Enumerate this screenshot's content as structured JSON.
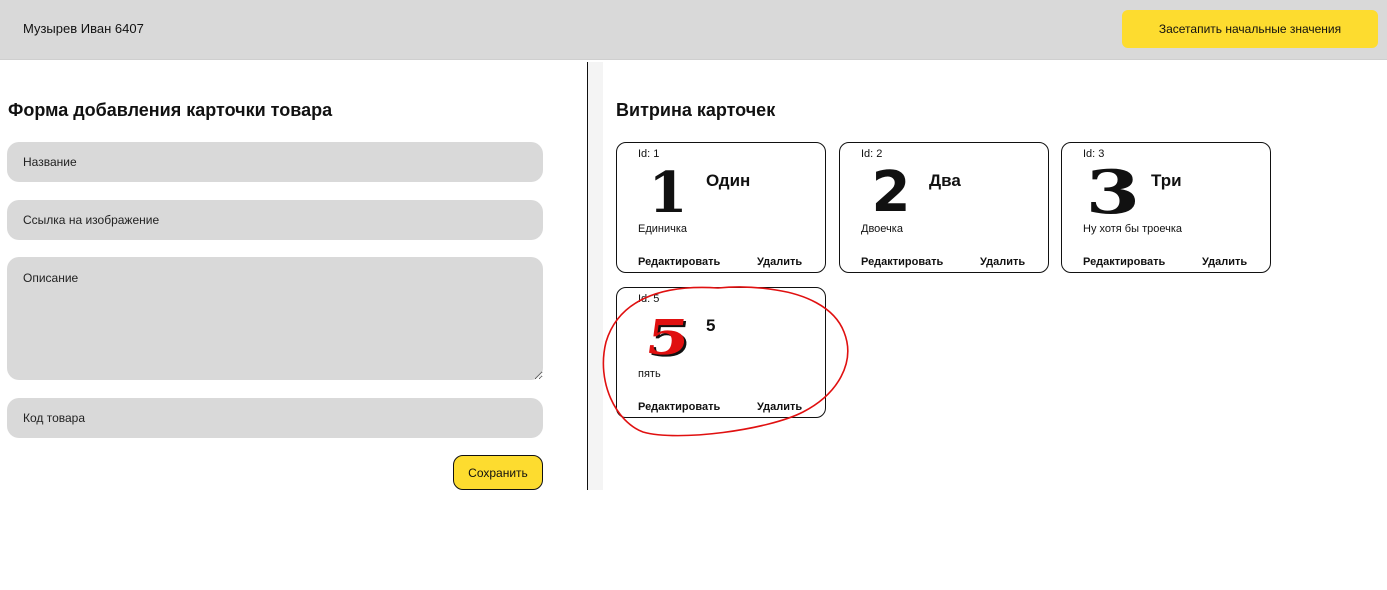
{
  "header": {
    "user": "Музырев Иван 6407",
    "reset_label": "Засетапить начальные значения"
  },
  "form": {
    "title": "Форма добавления карточки товара",
    "name_placeholder": "Название",
    "image_placeholder": "Ссылка на изображение",
    "description_placeholder": "Описание",
    "code_placeholder": "Код товара",
    "save_label": "Сохранить"
  },
  "showcase": {
    "title": "Витрина карточек",
    "cards": [
      {
        "id_label": "Id: 1",
        "title": "Один",
        "description": "Единичка",
        "image_glyph": "1",
        "image_color": "#111111",
        "edit_label": "Редактировать",
        "delete_label": "Удалить"
      },
      {
        "id_label": "Id: 2",
        "title": "Два",
        "description": "Двоечка",
        "image_glyph": "2",
        "image_color": "#111111",
        "edit_label": "Редактировать",
        "delete_label": "Удалить"
      },
      {
        "id_label": "Id: 3",
        "title": "Три",
        "description": "Ну хотя бы троечка",
        "image_glyph": "3",
        "image_color": "#111111",
        "edit_label": "Редактировать",
        "delete_label": "Удалить"
      },
      {
        "id_label": "Id: 5",
        "title": "5",
        "description": "пять",
        "image_glyph": "5",
        "image_color": "#e01010",
        "edit_label": "Редактировать",
        "delete_label": "Удалить"
      }
    ]
  },
  "colors": {
    "accent": "#fddc2f",
    "header_bg": "#d9d9d9",
    "annotation": "#e01010"
  }
}
